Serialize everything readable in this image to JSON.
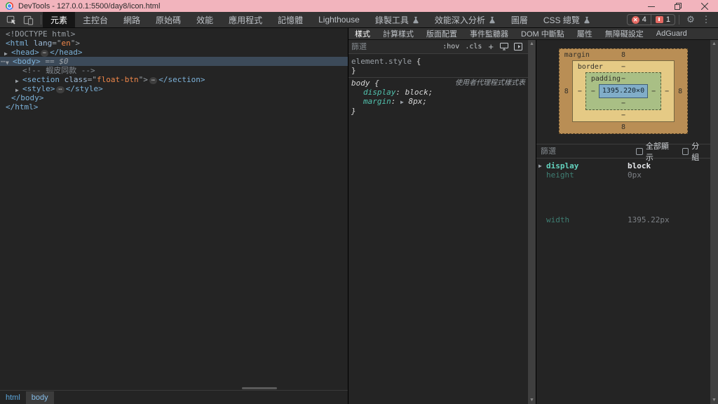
{
  "window": {
    "title": "DevTools - 127.0.0.1:5500/day8/icon.html"
  },
  "icons": {
    "scroll_up": "▲",
    "scroll_down": "▼",
    "gear": "⚙",
    "kebab": "⋮",
    "expand_right": "▶",
    "expand_down": "▼"
  },
  "main_toolbar": {
    "tabs": [
      {
        "name": "elements",
        "label": "元素",
        "selected": true
      },
      {
        "name": "console",
        "label": "主控台"
      },
      {
        "name": "network",
        "label": "網路"
      },
      {
        "name": "sources",
        "label": "原始碼"
      },
      {
        "name": "performance",
        "label": "效能"
      },
      {
        "name": "application",
        "label": "應用程式"
      },
      {
        "name": "memory",
        "label": "記憶體"
      },
      {
        "name": "lighthouse",
        "label": "Lighthouse"
      },
      {
        "name": "recorder",
        "label": "錄製工具",
        "experimental": true
      },
      {
        "name": "performance-insights",
        "label": "效能深入分析",
        "experimental": true
      },
      {
        "name": "layers",
        "label": "圖層"
      },
      {
        "name": "css-overview",
        "label": "CSS 總覽",
        "experimental": true
      }
    ],
    "error_count": "4",
    "issue_count": "1"
  },
  "elements_panel": {
    "tree": [
      {
        "indent": 8,
        "tokens": [
          [
            "doctype",
            "<!DOCTYPE html>"
          ]
        ]
      },
      {
        "indent": 8,
        "tokens": [
          [
            "tag",
            "<html"
          ],
          [
            "attr",
            " lang"
          ],
          [
            "punct",
            "=\""
          ],
          [
            "val",
            "en"
          ],
          [
            "punct",
            "\">"
          ]
        ]
      },
      {
        "indent": 16,
        "arrow": "right",
        "tokens": [
          [
            "tag",
            "<head>"
          ],
          [
            "dots",
            "⋯"
          ],
          [
            "tag",
            "</head>"
          ]
        ]
      },
      {
        "indent": 18,
        "arrow": "down",
        "selected": true,
        "gutter": "⋯",
        "tokens": [
          [
            "tag",
            "<body>"
          ],
          [
            "flag",
            " == $0"
          ]
        ]
      },
      {
        "indent": 32,
        "tokens": [
          [
            "comment",
            "<!-- 蝦皮同款 -->"
          ]
        ]
      },
      {
        "indent": 32,
        "arrow": "right",
        "tokens": [
          [
            "tag",
            "<section"
          ],
          [
            "attr",
            " class"
          ],
          [
            "punct",
            "=\""
          ],
          [
            "val",
            "float-btn"
          ],
          [
            "punct",
            "\">"
          ],
          [
            "dots",
            "⋯"
          ],
          [
            "tag",
            "</section>"
          ]
        ]
      },
      {
        "indent": 32,
        "arrow": "right",
        "tokens": [
          [
            "tag",
            "<style>"
          ],
          [
            "dots",
            "⋯"
          ],
          [
            "tag",
            "</style>"
          ]
        ]
      },
      {
        "indent": 16,
        "tokens": [
          [
            "tag",
            "</body>"
          ]
        ]
      },
      {
        "indent": 8,
        "tokens": [
          [
            "tag",
            "</html>"
          ]
        ]
      }
    ],
    "breadcrumbs": [
      {
        "label": "html"
      },
      {
        "label": "body",
        "selected": true
      }
    ]
  },
  "styles_pane": {
    "tabs": [
      {
        "name": "styles",
        "label": "樣式",
        "selected": true
      },
      {
        "name": "computed",
        "label": "計算樣式"
      },
      {
        "name": "layout",
        "label": "版面配置"
      },
      {
        "name": "event-listeners",
        "label": "事件監聽器"
      },
      {
        "name": "dom-breakpoints",
        "label": "DOM 中斷點"
      },
      {
        "name": "properties",
        "label": "屬性"
      },
      {
        "name": "accessibility",
        "label": "無障礙設定"
      },
      {
        "name": "adguard",
        "label": "AdGuard"
      }
    ],
    "filter_placeholder": "篩選",
    "pseudo_button": ":hov",
    "class_button": ".cls",
    "element_style_selector": "element.style",
    "open_brace": "{",
    "close_brace": "}",
    "body_rule": {
      "selector": "body",
      "origin": "使用者代理程式樣式表",
      "declarations": [
        {
          "name": "display",
          "value": "block;"
        },
        {
          "name": "margin",
          "value": "8px;",
          "expandable": true
        }
      ]
    }
  },
  "computed_pane": {
    "box_model": {
      "content": "1395.220×0",
      "margin": {
        "label": "margin",
        "top": "8",
        "right": "8",
        "bottom": "8",
        "left": "8"
      },
      "border": {
        "label": "border",
        "top": "−",
        "right": "−",
        "bottom": "−",
        "left": "−"
      },
      "padding": {
        "label": "padding",
        "top": "−",
        "right": "−",
        "bottom": "−",
        "left": "−"
      }
    },
    "filter_placeholder": "篩選",
    "show_all_label": "全部顯示",
    "group_label": "分組",
    "properties": [
      {
        "name": "display",
        "value": "block",
        "emphasized": true,
        "expandable": true
      },
      {
        "name": "height",
        "value": "0px",
        "dimmed": true
      },
      {
        "name": "width",
        "value": "1395.22px",
        "dimmed": true,
        "gap_before": true
      }
    ]
  }
}
